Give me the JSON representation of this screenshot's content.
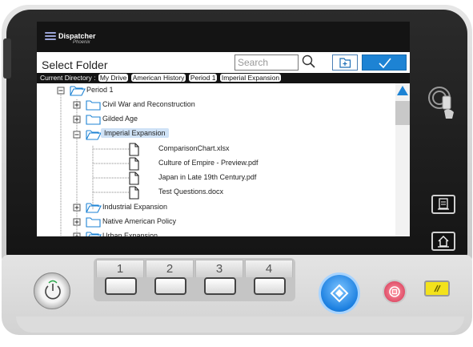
{
  "app": {
    "brand": "Dispatcher",
    "brand_sub": "Phoenix"
  },
  "dialog": {
    "title": "Select Folder"
  },
  "search": {
    "placeholder": "Search"
  },
  "path": {
    "label": "Current Directory :",
    "crumbs": [
      "My Drive",
      "American History",
      "Period 1",
      "Imperial Expansion"
    ]
  },
  "tree": [
    {
      "label": "Period 1",
      "kind": "folder-open",
      "expander": "minus",
      "level": 0
    },
    {
      "label": "Civil War and Reconstruction",
      "kind": "folder",
      "expander": "plus",
      "level": 1
    },
    {
      "label": "Gilded Age",
      "kind": "folder",
      "expander": "plus",
      "level": 1
    },
    {
      "label": "Imperial Expansion",
      "kind": "folder-open",
      "expander": "minus",
      "level": 1,
      "selected": true
    },
    {
      "label": "ComparisonChart.xlsx",
      "kind": "file",
      "level": 2
    },
    {
      "label": "Culture of Empire - Preview.pdf",
      "kind": "file",
      "level": 2
    },
    {
      "label": "Japan in Late 19th Century.pdf",
      "kind": "file",
      "level": 2
    },
    {
      "label": "Test Questions.docx",
      "kind": "file",
      "level": 2
    },
    {
      "label": "Industrial Expansion",
      "kind": "folder-open",
      "expander": "plus",
      "level": 1
    },
    {
      "label": "Native American Policy",
      "kind": "folder",
      "expander": "plus",
      "level": 1
    },
    {
      "label": "Urban Expansion",
      "kind": "folder-open",
      "expander": "plus",
      "level": 1
    }
  ],
  "keypad": {
    "tabs": [
      "1",
      "2",
      "3",
      "4"
    ]
  },
  "colors": {
    "accent": "#1d83d4",
    "selection": "#cfe2f6",
    "start": "#1b7fe0",
    "stop": "#e0506a",
    "reset": "#f3e21b"
  }
}
